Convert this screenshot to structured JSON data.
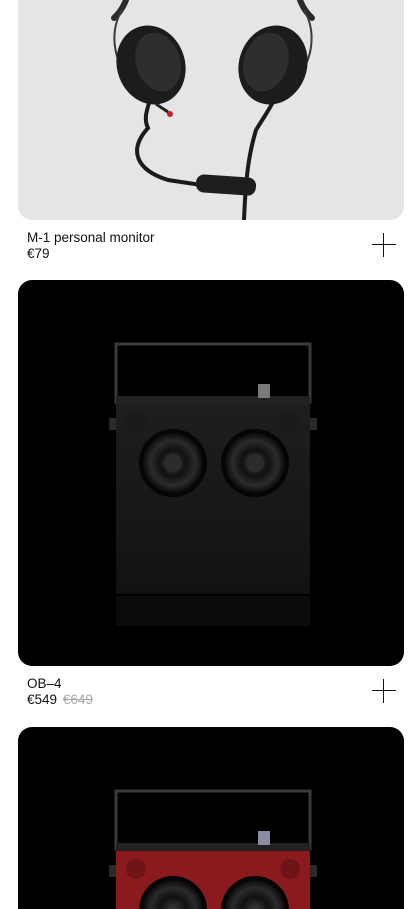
{
  "products": [
    {
      "name": "M-1 personal monitor",
      "price": "€79",
      "old_price": "",
      "image_icon": "headphones-image"
    },
    {
      "name": "OB–4",
      "price": "€549",
      "old_price": "€649",
      "image_icon": "speaker-black-image"
    },
    {
      "name": "",
      "price": "",
      "old_price": "",
      "image_icon": "speaker-red-image"
    }
  ],
  "colors": {
    "card_bg_light": "#e5e5e5",
    "card_bg_dark": "#000000",
    "old_price": "#a8a8a8",
    "speaker_red": "#8b1a1e"
  }
}
